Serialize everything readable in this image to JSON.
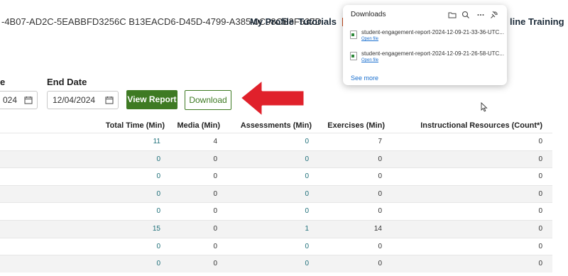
{
  "header": {
    "session_id": "-4B07-AD2C-5EABBFD3256C B13EACD6-D45D-4799-A385-0C98CB3F537D",
    "nav": [
      "My Profile",
      "Tutorials",
      "line Training"
    ]
  },
  "filters": {
    "start_date_label": "e",
    "start_date_value": "024",
    "end_date_label": "End Date",
    "end_date_value": "12/04/2024",
    "view_report_label": "View Report",
    "download_label": "Download"
  },
  "table": {
    "columns": [
      "Total Time (Min)",
      "Media (Min)",
      "Assessments (Min)",
      "Exercises (Min)",
      "Instructional Resources (Count*)"
    ],
    "rows": [
      [
        "11",
        "4",
        "0",
        "7",
        "0"
      ],
      [
        "0",
        "0",
        "0",
        "0",
        "0"
      ],
      [
        "0",
        "0",
        "0",
        "0",
        "0"
      ],
      [
        "0",
        "0",
        "0",
        "0",
        "0"
      ],
      [
        "0",
        "0",
        "0",
        "0",
        "0"
      ],
      [
        "15",
        "0",
        "1",
        "14",
        "0"
      ],
      [
        "0",
        "0",
        "0",
        "0",
        "0"
      ],
      [
        "0",
        "0",
        "0",
        "0",
        "0"
      ]
    ]
  },
  "downloads": {
    "title": "Downloads",
    "items": [
      {
        "name": "student-engagement-report-2024-12-09-21-33-36-UTC...",
        "action": "Open file"
      },
      {
        "name": "student-engagement-report-2024-12-09-21-26-58-UTC...",
        "action": "Open file"
      }
    ],
    "see_more": "See more"
  },
  "colors": {
    "primary_green": "#3e7a23",
    "link_teal": "#1d6f79",
    "arrow_red": "#e0212b"
  }
}
